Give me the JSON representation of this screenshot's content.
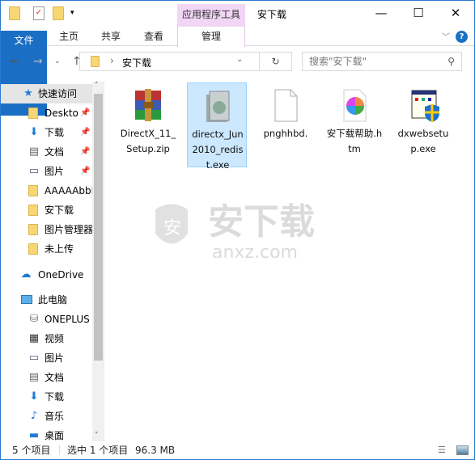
{
  "window": {
    "title": "安下载",
    "context_tab": "应用程序工具",
    "minimize": "—",
    "maximize": "☐",
    "close": "✕"
  },
  "ribbon": {
    "tabs": [
      "文件",
      "主页",
      "共享",
      "查看"
    ],
    "context_tab": "管理",
    "help": "?"
  },
  "address": {
    "path": "安下载",
    "search_placeholder": "搜索\"安下载\""
  },
  "nav": {
    "quick_access": "快速访问",
    "items": [
      {
        "label": "Deskto",
        "icon": "folder-icon",
        "pinned": true
      },
      {
        "label": "下载",
        "icon": "download-icon",
        "pinned": true
      },
      {
        "label": "文档",
        "icon": "document-icon",
        "pinned": true
      },
      {
        "label": "图片",
        "icon": "pictures-icon",
        "pinned": true
      },
      {
        "label": "AAAAAbbl",
        "icon": "folder-icon"
      },
      {
        "label": "安下载",
        "icon": "folder-icon"
      },
      {
        "label": "图片管理器",
        "icon": "folder-icon"
      },
      {
        "label": "未上传",
        "icon": "folder-icon"
      }
    ],
    "onedrive": "OneDrive",
    "this_pc": "此电脑",
    "pc_items": [
      {
        "label": "ONEPLUS",
        "icon": "phone-drive-icon"
      },
      {
        "label": "视频",
        "icon": "video-icon"
      },
      {
        "label": "图片",
        "icon": "pictures-icon"
      },
      {
        "label": "文档",
        "icon": "document-icon"
      },
      {
        "label": "下载",
        "icon": "download-icon"
      },
      {
        "label": "音乐",
        "icon": "music-icon"
      },
      {
        "label": "桌面",
        "icon": "desktop-icon"
      }
    ]
  },
  "files": [
    {
      "name": "DirectX_11_Setup.zip",
      "icon": "winrar-archive-icon",
      "selected": false
    },
    {
      "name": "directx_Jun2010_redist.exe",
      "icon": "installer-icon",
      "selected": true
    },
    {
      "name": "pnghhbd.",
      "icon": "blank-file-icon",
      "selected": false
    },
    {
      "name": "安下载帮助.htm",
      "icon": "browser-html-icon",
      "selected": false
    },
    {
      "name": "dxwebsetup.exe",
      "icon": "setup-shield-icon",
      "selected": false
    }
  ],
  "status": {
    "count": "5 个项目",
    "selection": "选中 1 个项目",
    "size": "96.3 MB"
  },
  "watermark": {
    "text": "安下载",
    "url": "anxz.com"
  },
  "colors": {
    "accent": "#1a6fc4",
    "context_tab": "#f2d6f5",
    "selection": "#cce8ff"
  }
}
